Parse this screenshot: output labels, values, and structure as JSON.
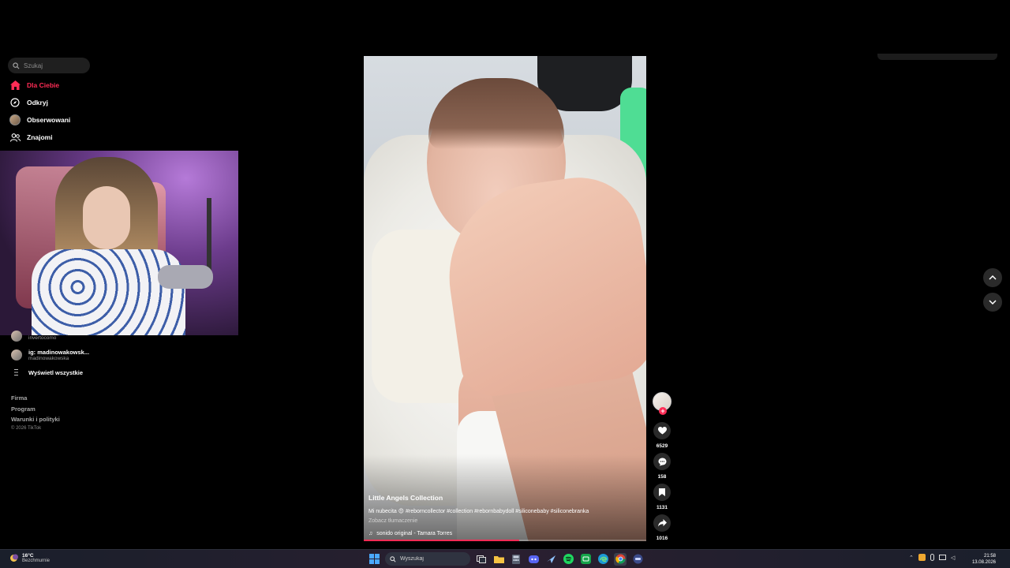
{
  "sidebar": {
    "search_placeholder": "Szukaj",
    "nav": [
      {
        "label": "Dla Ciebie",
        "icon": "home-icon",
        "active": true
      },
      {
        "label": "Odkryj",
        "icon": "compass-icon"
      },
      {
        "label": "Obserwowani",
        "icon": "avatar"
      },
      {
        "label": "Znajomi",
        "icon": "friends-icon"
      }
    ],
    "following": [
      {
        "name": "invertocomo",
        "handle": "invertocomo"
      },
      {
        "name": "ig: madinowakowsk...",
        "handle": "madinowakowska"
      }
    ],
    "show_all": "Wyświetl wszystkie",
    "footer": [
      "Firma",
      "Program",
      "Warunki i polityki"
    ],
    "copyright": "© 2026 TikTok"
  },
  "video": {
    "author": "Little Angels Collection",
    "description": "Mi nubecita 😍 #reborncollector #collection #rebornbabydoll #siliconebaby #siliconebranka",
    "translate": "Zobacz tłumaczenie",
    "sound": "sonido original - Tamara Torres",
    "progress": 0.55
  },
  "actions": {
    "likes": "6529",
    "comments": "158",
    "saves": "1131",
    "shares": "1016"
  },
  "taskbar": {
    "temperature": "16°C",
    "condition": "Bezchmurnie",
    "search_placeholder": "Wyszukaj",
    "time": "21:58",
    "date": "13.08.2026"
  },
  "colors": {
    "accent": "#fe2c55",
    "background": "#000000"
  }
}
